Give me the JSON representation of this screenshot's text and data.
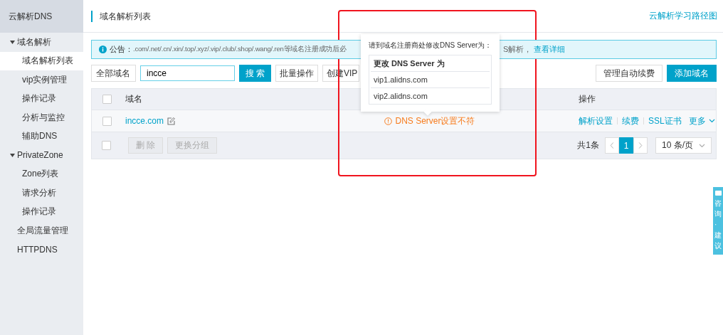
{
  "sidebar": {
    "title": "云解析DNS",
    "nav": [
      {
        "label": "域名解析",
        "expanded": true,
        "children": [
          {
            "label": "域名解析列表",
            "selected": true
          },
          {
            "label": "vip实例管理",
            "selected": false
          },
          {
            "label": "操作记录",
            "selected": false
          },
          {
            "label": "分析与监控",
            "selected": false
          },
          {
            "label": "辅助DNS",
            "selected": false
          }
        ]
      },
      {
        "label": "PrivateZone",
        "expanded": true,
        "children": [
          {
            "label": "Zone列表",
            "selected": false
          },
          {
            "label": "请求分析",
            "selected": false
          },
          {
            "label": "操作记录",
            "selected": false
          }
        ]
      },
      {
        "label": "全局流量管理",
        "selected": false
      },
      {
        "label": "HTTPDNS",
        "selected": false
      }
    ]
  },
  "header": {
    "title": "域名解析列表",
    "link": "云解析学习路径图"
  },
  "notice": {
    "label": "公告：",
    "text": ".com/.net/.cn/.xin/.top/.xyz/.vip/.club/.shop/.wang/.ren等域名注册成功后必",
    "text_tail": "S解析，",
    "link": "查看详细"
  },
  "toolbar": {
    "filter": "全部域名",
    "search_value": "incce",
    "search_button": "搜 索",
    "buttons": [
      "批量操作",
      "创建VIP"
    ],
    "right_buttons": [
      {
        "label": "管理自动续费",
        "primary": false
      },
      {
        "label": "添加域名",
        "primary": true
      }
    ]
  },
  "table": {
    "header_checked": false,
    "columns": [
      "域名",
      "操作"
    ],
    "rows": [
      {
        "checked": false,
        "domain": "incce.com",
        "status": "DNS Server设置不符",
        "actions": [
          "解析设置",
          "续费",
          "SSL证书"
        ],
        "more": "更多"
      }
    ],
    "footer": {
      "checked": false,
      "buttons": [
        {
          "label": "删 除",
          "disabled": true
        },
        {
          "label": "更换分组",
          "disabled": true
        }
      ],
      "total": "共1条",
      "pages": [
        {
          "label": "1",
          "selected": true
        }
      ],
      "page_size": "10 条/页"
    }
  },
  "popover": {
    "intro": "请到域名注册商处修改DNS Server为：",
    "heading": "更改 DNS Server 为",
    "servers": [
      "vip1.alidns.com",
      "vip2.alidns.com"
    ]
  },
  "feedback": {
    "label": "咨询·建议"
  }
}
